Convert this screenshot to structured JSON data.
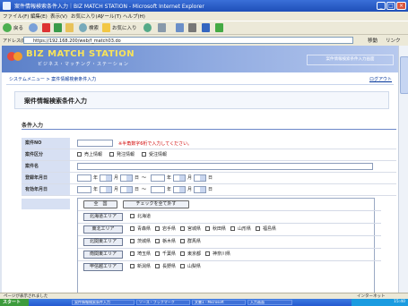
{
  "window": {
    "title": "案件情報検索条件入力｜BIZ MATCH STATION - Microsoft Internet Explorer",
    "controls": [
      "_",
      "□",
      "×"
    ]
  },
  "menu": [
    "ファイル(F)",
    "編集(E)",
    "表示(V)",
    "お気に入り(A)",
    "ツール(T)",
    "ヘルプ(H)"
  ],
  "toolbar": {
    "back": "戻る",
    "search": "検索",
    "favorites": "お気に入り"
  },
  "address": {
    "label": "アドレス(D)",
    "url": "https://192.168.200/web/f_match03.do",
    "go": "移動",
    "links": "リンク"
  },
  "site": {
    "logo_main": "BIZ MATCH STATION",
    "logo_sub": "ビジネス・マッチング・ステーション",
    "banner_right": "案件情報検索条件入力画面",
    "breadcrumb": "システムメニュー > 案件情報検索条件入力",
    "logout": "ログアウト"
  },
  "page": {
    "title": "案件情報検索条件入力",
    "section": "条件入力"
  },
  "form": {
    "case_no": {
      "label": "案件NO",
      "note": "※半角数字6桁で入力してください。"
    },
    "category": {
      "label": "案件区分",
      "options": [
        "売上情報",
        "発注情報",
        "受注情報"
      ]
    },
    "case_name": {
      "label": "案件名"
    },
    "register_date": {
      "label": "登録年月日",
      "year": "年",
      "month": "月",
      "day": "日",
      "range": "～"
    },
    "valid_date": {
      "label": "有効年月日",
      "year": "年",
      "month": "月",
      "day": "日",
      "range": "～"
    },
    "area": {
      "all_button": "全　国",
      "clear_button": "チェックを全て外す",
      "regions": [
        {
          "name": "北海道エリア",
          "prefs": [
            "北海道"
          ]
        },
        {
          "name": "東北エリア",
          "prefs": [
            "青森県",
            "岩手県",
            "宮城県",
            "秋田県",
            "山形県",
            "福島県"
          ]
        },
        {
          "name": "北関東エリア",
          "prefs": [
            "茨城県",
            "栃木県",
            "群馬県"
          ]
        },
        {
          "name": "南関東エリア",
          "prefs": [
            "埼玉県",
            "千葉県",
            "東京都",
            "神奈川県"
          ]
        },
        {
          "name": "甲信越エリア",
          "prefs": [
            "新潟県",
            "長野県",
            "山梨県"
          ]
        }
      ]
    }
  },
  "status": {
    "left": "ページが表示されました",
    "right": "インターネット"
  },
  "taskbar": {
    "start": "スタート",
    "tasks": [
      "案件情報検索条件入力",
      "ソース・ブックマーク",
      "文書1 - Microsoft",
      "入力画面"
    ],
    "clock": "15:40"
  }
}
